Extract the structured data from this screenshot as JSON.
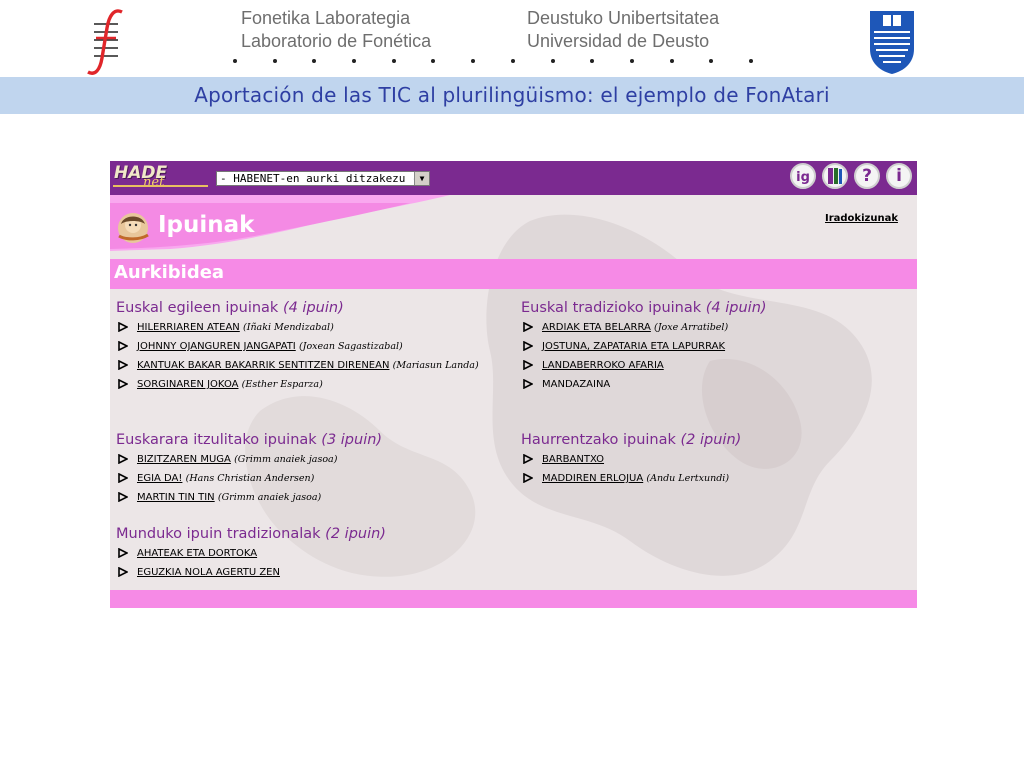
{
  "slide": {
    "header_left": [
      "Fonetika Laborategia",
      "Laboratorio de Fonética"
    ],
    "header_right": [
      "Deustuko Unibertsitatea",
      "Universidad de Deusto"
    ],
    "title": "Aportación de las TIC al plurilingüismo: el ejemplo de FonAtari",
    "colors": {
      "title_bar": "#c0d5ee",
      "title_text": "#2e3fa3"
    }
  },
  "app": {
    "logo": {
      "main": "HADE",
      "sub": "net"
    },
    "select_value": "- HABENET-en aurki ditzakezu -",
    "toolbar_icons": [
      "ig-icon",
      "book-icon",
      "help-icon",
      "info-icon"
    ],
    "toolbar_glyphs": {
      "ig": "ig",
      "book": "",
      "help": "?",
      "info": "i"
    },
    "page_title": "Ipuinak",
    "recommendations_link": "Iradokizunak",
    "section_title": "Aurkibidea",
    "colors": {
      "topbar": "#7b2a90",
      "pink": "#f68ae6",
      "category": "#7b2a90"
    }
  },
  "categories": {
    "c0": {
      "title": "Euskal egileen ipuinak",
      "count": "(4 ipuin)",
      "items": [
        {
          "title": "HILERRIAREN ATEAN",
          "author": "(Iñaki Mendizabal)"
        },
        {
          "title": "JOHNNY OJANGUREN JANGAPATI",
          "author": "(Joxean Sagastizabal)"
        },
        {
          "title": "KANTUAK BAKAR BAKARRIK SENTITZEN DIRENEAN",
          "author": "(Mariasun Landa)"
        },
        {
          "title": "SORGINAREN JOKOA",
          "author": "(Esther Esparza)"
        }
      ]
    },
    "c1": {
      "title": "Euskarara itzulitako ipuinak",
      "count": "(3 ipuin)",
      "items": [
        {
          "title": "BIZITZAREN MUGA",
          "author": "(Grimm anaiek jasoa)"
        },
        {
          "title": "EGIA DA!",
          "author": "(Hans Christian Andersen)"
        },
        {
          "title": "MARTIN TIN TIN",
          "author": "(Grimm anaiek jasoa)"
        }
      ]
    },
    "c2": {
      "title": "Munduko ipuin tradizionalak",
      "count": "(2 ipuin)",
      "items": [
        {
          "title": "AHATEAK ETA DORTOKA",
          "author": ""
        },
        {
          "title": "EGUZKIA NOLA AGERTU ZEN",
          "author": ""
        }
      ]
    },
    "c3": {
      "title": "Euskal tradizioko ipuinak",
      "count": "(4 ipuin)",
      "items": [
        {
          "title": "ARDIAK ETA BELARRA",
          "author": "(Joxe Arratibel)"
        },
        {
          "title": "JOSTUNA, ZAPATARIA ETA LAPURRAK",
          "author": ""
        },
        {
          "title": "LANDABERROKO AFARIA",
          "author": ""
        },
        {
          "title": "MANDAZAINA",
          "author": ""
        }
      ]
    },
    "c4": {
      "title": "Haurrentzako ipuinak",
      "count": "(2 ipuin)",
      "items": [
        {
          "title": "BARBANTXO",
          "author": ""
        },
        {
          "title": "MADDIREN ERLOJUA",
          "author": "(Andu Lertxundi)"
        }
      ]
    }
  }
}
